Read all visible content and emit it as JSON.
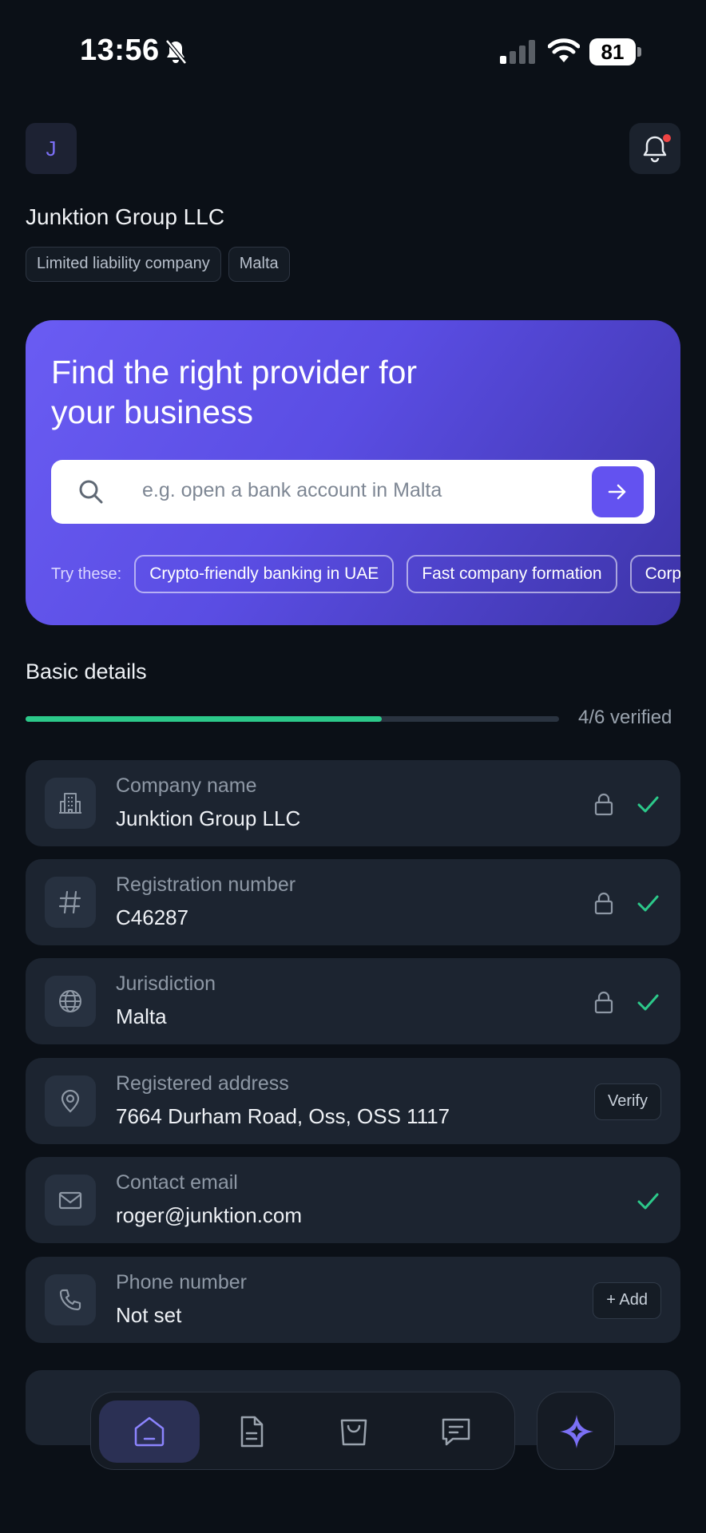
{
  "status_bar": {
    "time": "13:56",
    "battery": "81"
  },
  "header": {
    "avatar_initial": "J",
    "company_name": "Junktion Group LLC",
    "tags": [
      "Limited liability company",
      "Malta"
    ]
  },
  "hero": {
    "title": "Find the right provider for your business",
    "search_placeholder": "e.g. open a bank account in Malta",
    "try_label": "Try these:",
    "suggestions": [
      "Crypto-friendly banking in UAE",
      "Fast company formation",
      "Corp"
    ]
  },
  "basic_details": {
    "title": "Basic details",
    "progress_label": "4/6 verified",
    "progress_fraction": 0.667,
    "items": [
      {
        "label": "Company name",
        "value": "Junktion Group LLC",
        "icon": "building-icon"
      },
      {
        "label": "Registration number",
        "value": "C46287",
        "icon": "hash-icon"
      },
      {
        "label": "Jurisdiction",
        "value": "Malta",
        "icon": "globe-icon"
      },
      {
        "label": "Registered address",
        "value": "7664 Durham Road, Oss, OSS 1117",
        "icon": "map-pin-icon",
        "action": "Verify"
      },
      {
        "label": "Contact email",
        "value": "roger@junktion.com",
        "icon": "mail-icon"
      },
      {
        "label": "Phone number",
        "value": "Not set",
        "icon": "phone-icon",
        "action": "+ Add"
      }
    ]
  },
  "colors": {
    "accent": "#6352f0",
    "success": "#2cc98a",
    "background": "#0b1017",
    "card": "#1c2430"
  },
  "nav": {
    "items": [
      "home-icon",
      "document-icon",
      "shopping-bag-icon",
      "chat-icon"
    ],
    "fab": "sparkle-icon"
  }
}
